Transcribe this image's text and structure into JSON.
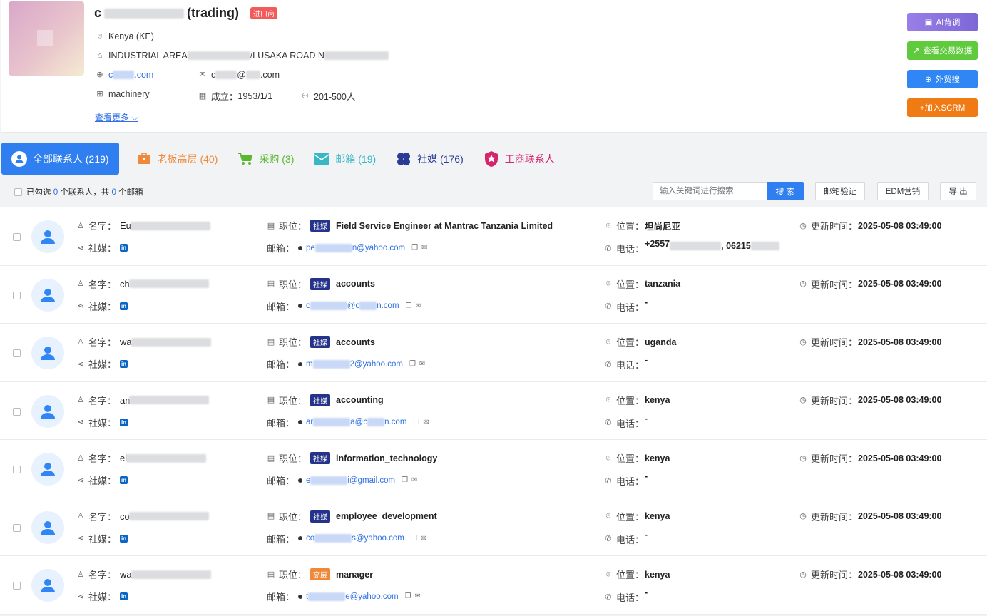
{
  "company": {
    "name_prefix": "c",
    "name_suffix": "(trading)",
    "tag": "进口商",
    "country": "Kenya (KE)",
    "address_a": "INDUSTRIAL AREA",
    "address_b": "/LUSAKA ROAD N",
    "website_prefix": "c",
    "website_suffix": ".com",
    "email_prefix": "c",
    "email_mid": "@",
    "email_suffix": ".com",
    "industry": "machinery",
    "founded_label": "成立：",
    "founded": "1953/1/1",
    "size": "201-500人",
    "more": "查看更多"
  },
  "actions": {
    "ai": "AI背调",
    "trade": "查看交易数据",
    "search": "外贸搜",
    "scrm": "+加入SCRM"
  },
  "tabs": [
    {
      "label": "全部联系人 (219)",
      "color": "#ffffff"
    },
    {
      "label": "老板高层 (40)",
      "color": "#f0883a"
    },
    {
      "label": "采购 (3)",
      "color": "#5ab830"
    },
    {
      "label": "邮箱 (19)",
      "color": "#38b8c5"
    },
    {
      "label": "社媒 (176)",
      "color": "#2b3a93"
    },
    {
      "label": "工商联系人",
      "color": "#d6256f"
    }
  ],
  "toolbar": {
    "sel_a": "已勾选",
    "sel_n1": "0",
    "sel_b": "个联系人，共",
    "sel_n2": "0",
    "sel_c": "个邮箱",
    "search_placeholder": "输入关键词进行搜索",
    "search_btn": "搜 索",
    "verify": "邮箱验证",
    "edm": "EDM营销",
    "export": "导 出"
  },
  "labels": {
    "name": "名字：",
    "social": "社媒：",
    "title": "职位：",
    "email": "邮箱：",
    "location": "位置：",
    "phone": "电话：",
    "updated": "更新时间："
  },
  "contacts": [
    {
      "name": "Eu",
      "badge": "社媒",
      "title": "Field Service Engineer at Mantrac Tanzania Limited",
      "email_a": "pe",
      "email_b": "n@yahoo.com",
      "location": "坦尚尼亚",
      "phone": "+2557",
      "phone_b": ", 06215",
      "updated": "2025-05-08 03:49:00"
    },
    {
      "name": "ch",
      "badge": "社媒",
      "title": "accounts",
      "email_a": "c",
      "email_b": "@c",
      "email_c": "n.com",
      "location": "tanzania",
      "phone": "-",
      "updated": "2025-05-08 03:49:00"
    },
    {
      "name": "wa",
      "badge": "社媒",
      "title": "accounts",
      "email_a": "m",
      "email_b": "2@yahoo.com",
      "location": "uganda",
      "phone": "-",
      "updated": "2025-05-08 03:49:00"
    },
    {
      "name": "an",
      "badge": "社媒",
      "title": "accounting",
      "email_a": "ar",
      "email_b": "a@c",
      "email_c": "n.com",
      "location": "kenya",
      "phone": "-",
      "updated": "2025-05-08 03:49:00"
    },
    {
      "name": "el",
      "badge": "社媒",
      "title": "information_technology",
      "email_a": "e",
      "email_b": "i@gmail.com",
      "location": "kenya",
      "phone": "-",
      "updated": "2025-05-08 03:49:00"
    },
    {
      "name": "co",
      "badge": "社媒",
      "title": "employee_development",
      "email_a": "co",
      "email_b": "s@yahoo.com",
      "location": "kenya",
      "phone": "-",
      "updated": "2025-05-08 03:49:00"
    },
    {
      "name": "wa",
      "badge": "高层",
      "title": "manager",
      "email_a": "t",
      "email_b": "e@yahoo.com",
      "location": "kenya",
      "phone": "-",
      "updated": "2025-05-08 03:49:00"
    }
  ]
}
